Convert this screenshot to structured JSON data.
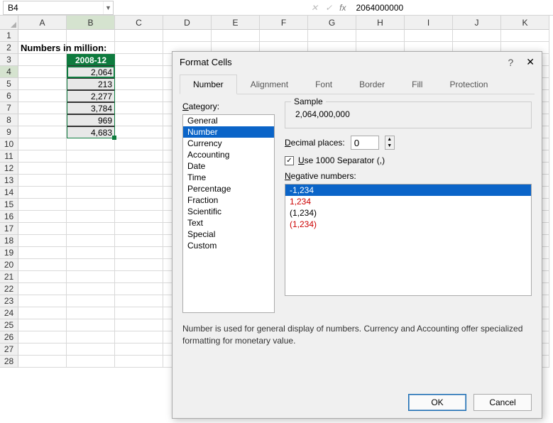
{
  "namebox": "B4",
  "formula_bar": "2064000000",
  "columns": [
    "A",
    "B",
    "C",
    "D",
    "E",
    "F",
    "G",
    "H",
    "I",
    "J",
    "K"
  ],
  "rows_count": 28,
  "spreadsheet": {
    "title_cell": "Numbers in million:",
    "header_cell": "2008-12",
    "values": [
      "2,064",
      "213",
      "2,277",
      "3,784",
      "969",
      "4,683"
    ]
  },
  "dialog": {
    "title": "Format Cells",
    "tabs": [
      "Number",
      "Alignment",
      "Font",
      "Border",
      "Fill",
      "Protection"
    ],
    "active_tab": 0,
    "category_label": "Category:",
    "categories": [
      "General",
      "Number",
      "Currency",
      "Accounting",
      "Date",
      "Time",
      "Percentage",
      "Fraction",
      "Scientific",
      "Text",
      "Special",
      "Custom"
    ],
    "category_selected": 1,
    "sample_label": "Sample",
    "sample_value": "2,064,000,000",
    "decimal_label_pre": "D",
    "decimal_label_post": "ecimal places:",
    "decimal_value": "0",
    "separator_pre": "U",
    "separator_post": "se 1000 Separator (,)",
    "separator_checked": true,
    "negative_label_pre": "N",
    "negative_label_post": "egative numbers:",
    "negatives": [
      {
        "text": "-1,234",
        "red": false,
        "sel": true
      },
      {
        "text": "1,234",
        "red": true,
        "sel": false
      },
      {
        "text": "(1,234)",
        "red": false,
        "sel": false
      },
      {
        "text": "(1,234)",
        "red": true,
        "sel": false
      }
    ],
    "note": "Number is used for general display of numbers.  Currency and Accounting offer specialized formatting for monetary value.",
    "ok": "OK",
    "cancel": "Cancel"
  }
}
